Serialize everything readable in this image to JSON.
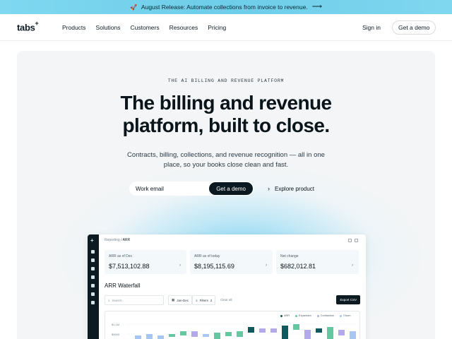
{
  "announcement": {
    "icon": "rocket-icon",
    "text": "August Release: Automate collections from invoice to revenue.",
    "arrow": "⟶"
  },
  "nav": {
    "logo": "tabs",
    "logo_mark": "+",
    "links": [
      "Products",
      "Solutions",
      "Customers",
      "Resources",
      "Pricing"
    ],
    "signin": "Sign in",
    "demo": "Get a demo"
  },
  "hero": {
    "eyebrow": "THE AI BILLING AND REVENUE PLATFORM",
    "headline_line1": "The billing and revenue",
    "headline_line2": "platform, built to close.",
    "subtext": "Contracts, billing, collections, and revenue recognition — all in one place, so your books close clean and fast.",
    "email_placeholder": "Work email",
    "email_button": "Get a demo",
    "explore": "Explore product"
  },
  "app": {
    "breadcrumb_parent": "Reporting /",
    "breadcrumb_current": "ARR",
    "kpis": [
      {
        "label": "ARR as of Dec",
        "value": "$7,513,102.88",
        "arrow": "›"
      },
      {
        "label": "ARR as of today",
        "value": "$8,195,115.69",
        "arrow": "›"
      },
      {
        "label": "Net change",
        "value": "$682,012.81",
        "arrow": "›"
      }
    ],
    "waterfall_title": "ARR Waterfall",
    "search_placeholder": "Search",
    "date_filter": "Jan-Dec",
    "filters_label": "Filters",
    "filters_count": "2",
    "clear_label": "Clear all",
    "export_label": "Export CSV",
    "legend": [
      {
        "name": "ARR",
        "color": "#0f5a5e"
      },
      {
        "name": "Expansion",
        "color": "#63c7a2"
      },
      {
        "name": "Contraction",
        "color": "#b4a9ea"
      },
      {
        "name": "Churn",
        "color": "#a6c7f2"
      }
    ],
    "y_ticks": [
      "$1.1M",
      "$900K"
    ],
    "colors": {
      "sidebar": "#0c1a22",
      "accent": "#74d0ec"
    }
  }
}
